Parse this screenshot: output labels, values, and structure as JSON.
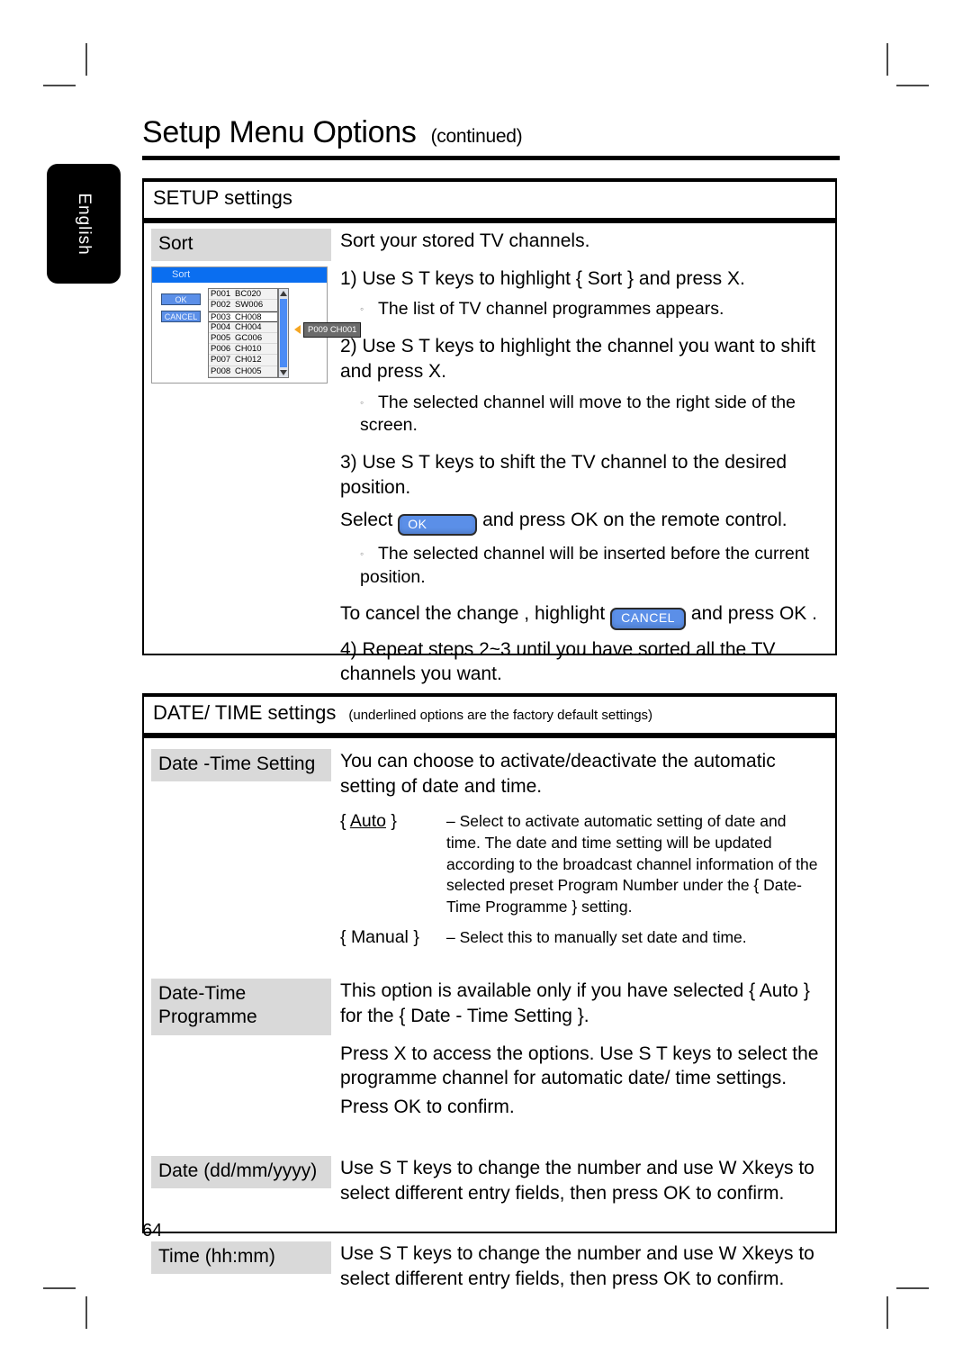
{
  "header": {
    "title": "Setup Menu Options",
    "continued": "(continued)"
  },
  "language_tab": {
    "label": "English"
  },
  "page_number": "64",
  "setup_section": {
    "head_title": "SETUP settings",
    "row": {
      "tag": "Sort",
      "intro": "Sort your stored TV channels.",
      "step1": "1)  Use  S T  keys to highlight { Sort  } and press  X.",
      "step1_note": "The list of TV channel programmes appears.",
      "step2": "2)  Use  S T  keys to highlight the channel you want to shift and press  X.",
      "step2_note": "The selected channel will move to the right side of the screen.",
      "step3_a": "3)  Use  S T  keys to shift the TV channel to the desired position.",
      "step3_b_pre": "Select",
      "step3_b_btn": "OK",
      "step3_b_post": "and press OK  on the remote control.",
      "step3_note": "The selected channel will be inserted before the current position.",
      "cancel_pre": "To cancel the change , highlight",
      "cancel_btn": "CANCEL",
      "cancel_post": "and press OK .",
      "step4": "4) Repeat steps 2~3 until you have sorted all the TV channels you want."
    },
    "tv_mock": {
      "title": "Sort",
      "ok_label": "OK",
      "cancel_label": "CANCEL",
      "channels": [
        {
          "pn": "P001",
          "ch": "BC020"
        },
        {
          "pn": "P002",
          "ch": "SW006"
        },
        {
          "pn": "P003",
          "ch": "CH008"
        },
        {
          "pn": "P004",
          "ch": "CH004"
        },
        {
          "pn": "P005",
          "ch": "GC006"
        },
        {
          "pn": "P006",
          "ch": "CH010"
        },
        {
          "pn": "P007",
          "ch": "CH012"
        },
        {
          "pn": "P008",
          "ch": "CH005"
        }
      ],
      "selected_index": 2,
      "moved_channel": "P009 CH001"
    }
  },
  "datetime_section": {
    "head_title": "DATE/ TIME settings",
    "head_note": "(underlined options are the factory default settings)",
    "rows": [
      {
        "tag": "Date -Time Setting",
        "intro": "You can choose to activate/deactivate the automatic setting of date and time.",
        "options": [
          {
            "name_pre": "{ ",
            "name": "Auto",
            "name_post": " }",
            "desc": "– Select to activate automatic setting of date and time. The date and time setting will be updated according to the broadcast channel information of the selected preset Program Number under the { Date-Time Programme    } setting."
          },
          {
            "name_pre": "{ ",
            "name": "Manual",
            "name_post": " }",
            "desc": "– Select this to manually set date and time."
          }
        ]
      },
      {
        "tag_line1": "Date-Time",
        "tag_line2": "Programme",
        "para1": "This option is available only if you have selected { Auto  } for the { Date - Time Setting   }.",
        "para2": "Press   X to access the options. Use  S T  keys to select the programme channel for automatic date/ time settings.",
        "para3": "Press OK  to confirm."
      },
      {
        "tag": "Date (dd/mm/yyyy)",
        "para1": "Use  S T  keys to change the number and use  W Xkeys to select different entry fields, then press OK  to confirm."
      },
      {
        "tag": "Time (hh:mm)",
        "para1": "Use  S T  keys to change the number and use  W Xkeys to select different entry fields, then press OK  to confirm."
      }
    ]
  }
}
